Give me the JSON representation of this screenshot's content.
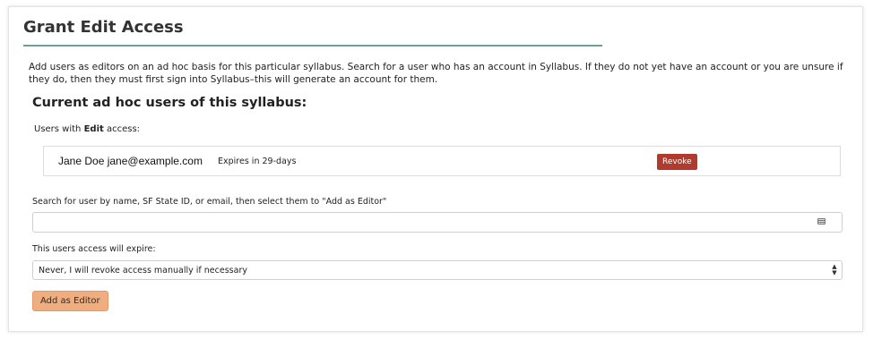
{
  "page": {
    "title": "Grant Edit Access",
    "intro": "Add users as editors on an ad hoc basis for this particular syllabus. Search for a user who has an account in Syllabus. If they do not yet have an account or you are unsure if they do, then they must first sign into Syllabus–this will generate an account for them."
  },
  "current_users": {
    "heading": "Current ad hoc users of this syllabus:",
    "label_prefix": "Users with ",
    "label_bold": "Edit",
    "label_suffix": " access:",
    "users": [
      {
        "name": "Jane Doe jane@example.com",
        "expiry": "Expires in 29-days",
        "revoke_label": "Revoke"
      }
    ]
  },
  "search": {
    "label": "Search for user by name, SF State ID, or email, then select them to \"Add as Editor\"",
    "value": "",
    "icon": "keyboard-icon"
  },
  "expiration": {
    "label": "This users access will expire:",
    "selected": "Never, I will revoke access manually if necessary"
  },
  "actions": {
    "add_label": "Add as Editor"
  },
  "colors": {
    "title_rule": "#6a9fa0",
    "revoke_button": "#b03a2e",
    "add_button": "#f0ad80"
  }
}
